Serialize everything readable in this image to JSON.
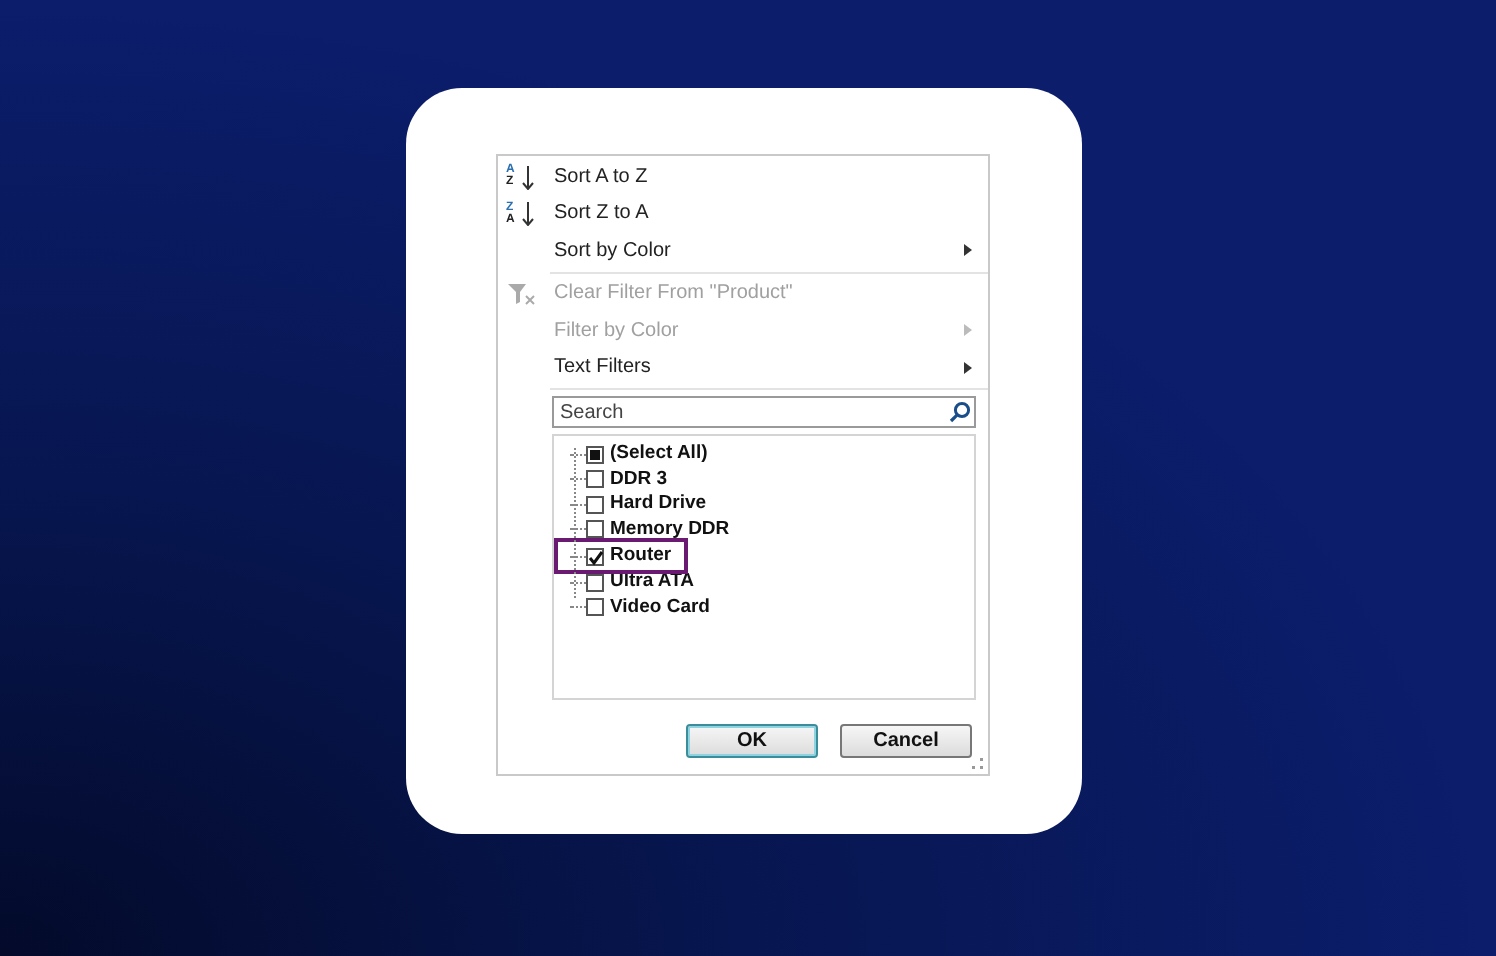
{
  "menu": [
    {
      "label": "Sort A to Z",
      "icon_text": [
        "A",
        "Z"
      ],
      "disabled": false,
      "submenu": false,
      "separator_after": false
    },
    {
      "label": "Sort Z to A",
      "icon_text": [
        "Z",
        "A"
      ],
      "disabled": false,
      "submenu": false,
      "separator_after": false
    },
    {
      "label": "Sort by Color",
      "disabled": false,
      "submenu": true,
      "separator_after": true
    },
    {
      "label": "Clear Filter From \"Product\"",
      "disabled": true,
      "submenu": false,
      "separator_after": false
    },
    {
      "label": "Filter by Color",
      "disabled": true,
      "submenu": true,
      "separator_after": false
    },
    {
      "label": "Text Filters",
      "disabled": false,
      "submenu": true,
      "separator_after": true
    }
  ],
  "search": {
    "placeholder": "Search"
  },
  "values": [
    {
      "label": "(Select All)",
      "checked": false,
      "partial": true,
      "highlighted": false
    },
    {
      "label": "DDR 3",
      "checked": false,
      "partial": false,
      "highlighted": false
    },
    {
      "label": "Hard Drive",
      "checked": false,
      "partial": false,
      "highlighted": false
    },
    {
      "label": "Memory DDR",
      "checked": false,
      "partial": false,
      "highlighted": false
    },
    {
      "label": "Router",
      "checked": true,
      "partial": false,
      "highlighted": true
    },
    {
      "label": "Ultra ATA",
      "checked": false,
      "partial": false,
      "highlighted": false
    },
    {
      "label": "Video Card",
      "checked": false,
      "partial": false,
      "highlighted": false
    }
  ],
  "buttons": [
    {
      "label": "OK",
      "default": true
    },
    {
      "label": "Cancel",
      "default": false
    }
  ]
}
